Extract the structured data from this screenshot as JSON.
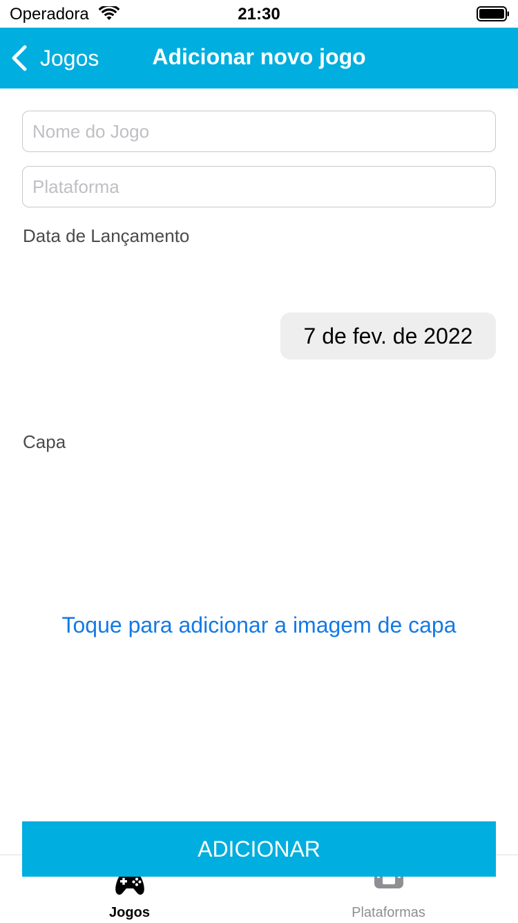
{
  "status_bar": {
    "carrier": "Operadora",
    "time": "21:30",
    "icons": [
      "wifi-icon",
      "battery-icon"
    ]
  },
  "nav": {
    "back_label": "Jogos",
    "title": "Adicionar novo jogo",
    "color": "#00AEDF",
    "back_icon": "chevron-left-icon"
  },
  "form": {
    "name_placeholder": "Nome do Jogo",
    "name_value": "",
    "platform_placeholder": "Plataforma",
    "platform_value": "",
    "release_date_label": "Data de Lançamento",
    "release_date_value": "7 de fev. de 2022",
    "cover_label": "Capa",
    "cover_action": "Toque para adicionar a imagem de capa",
    "link_color": "#1479E6"
  },
  "actions": {
    "add_label": "ADICIONAR",
    "button_color": "#00AEDF"
  },
  "tab_bar": {
    "tabs": [
      {
        "label": "Jogos",
        "icon": "gamepad-icon",
        "selected": true
      },
      {
        "label": "Plataformas",
        "icon": "handheld-console-icon",
        "selected": false
      }
    ]
  }
}
